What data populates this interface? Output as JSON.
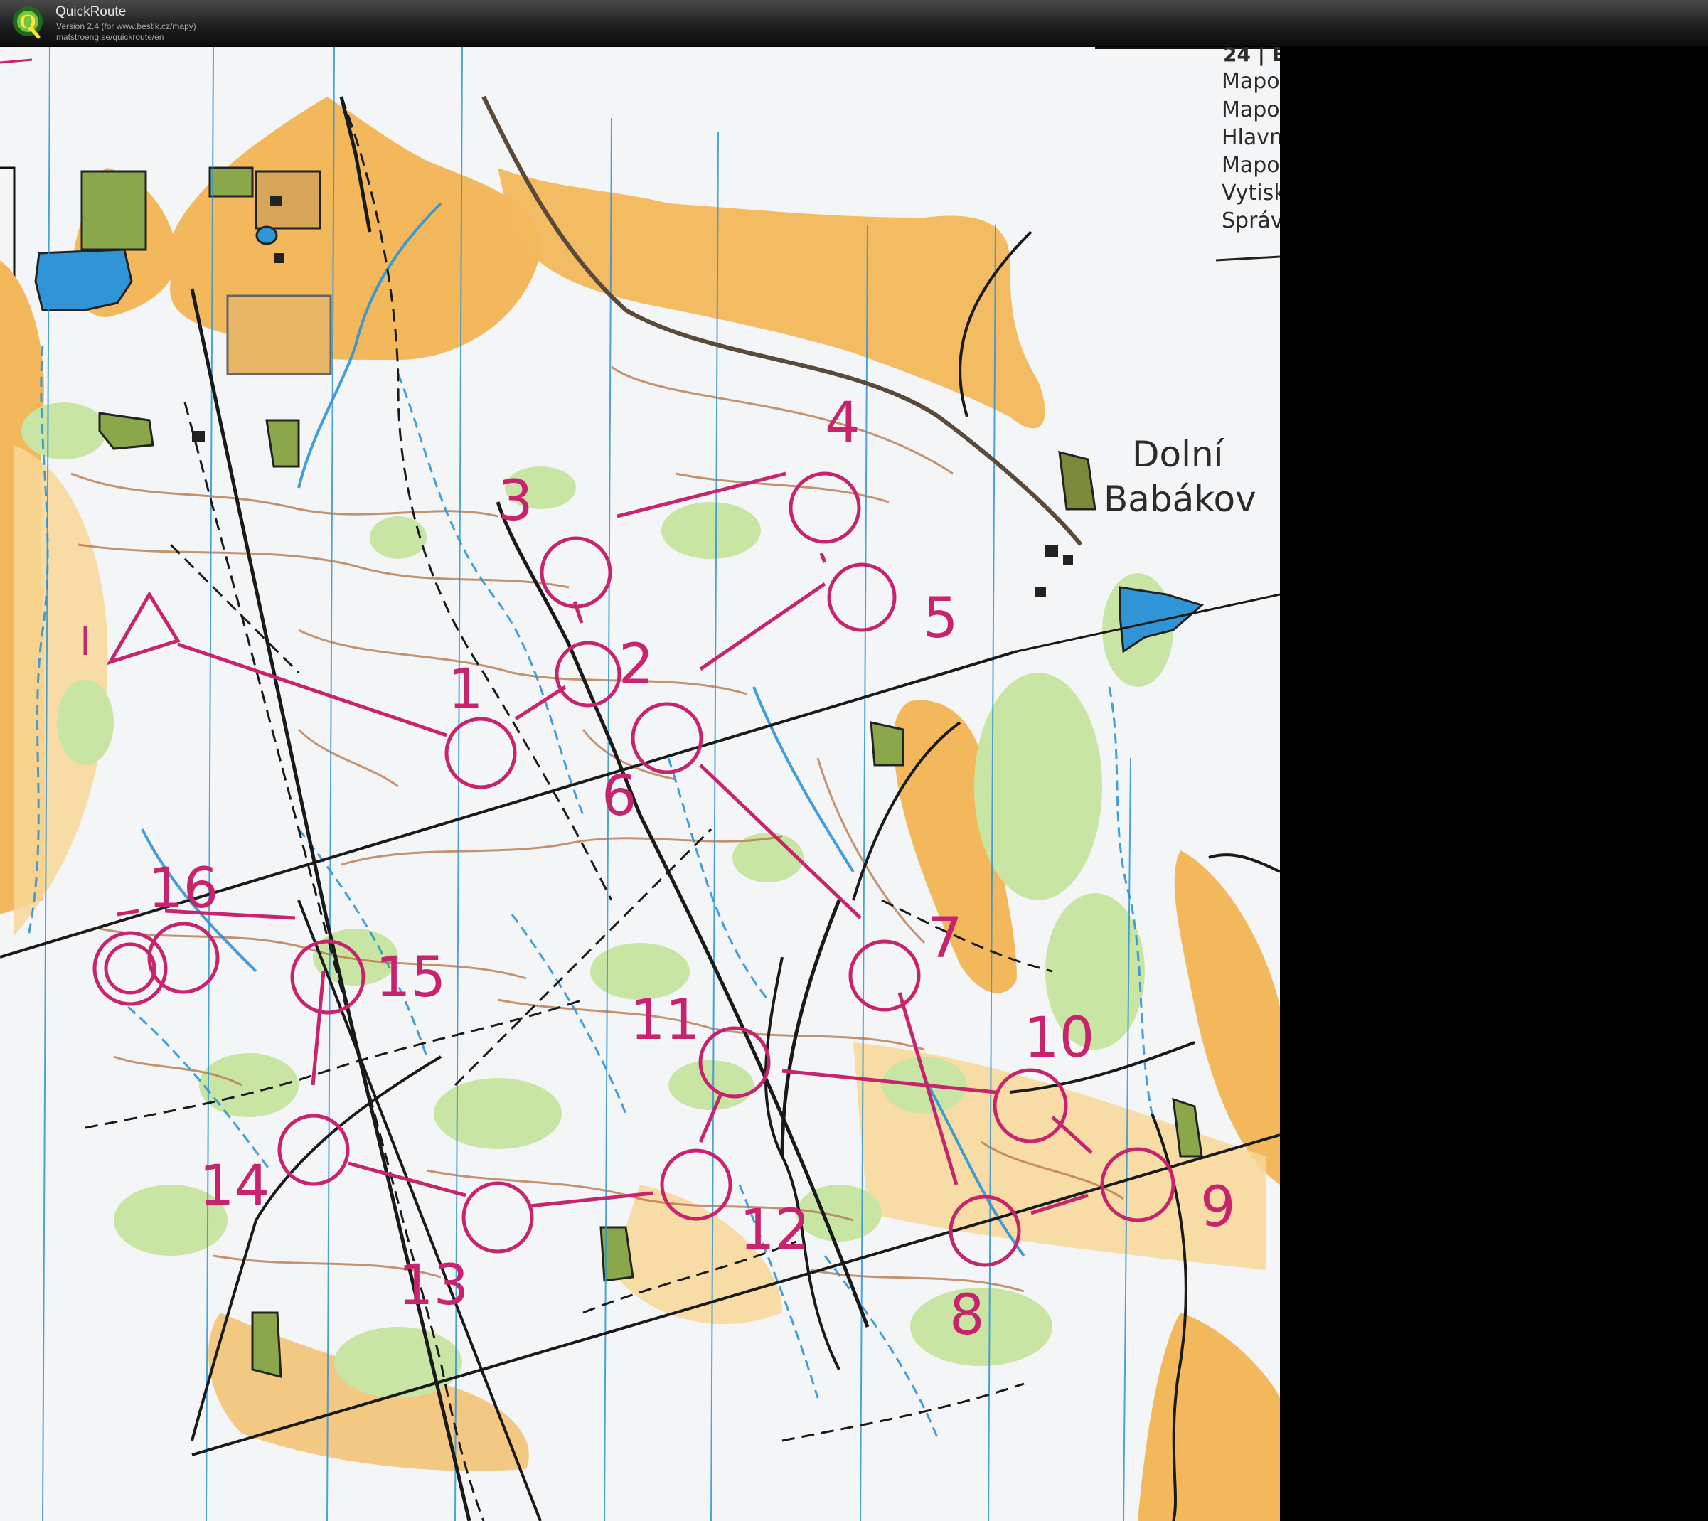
{
  "app": {
    "title": "QuickRoute",
    "version": "Version 2.4  (for www.bestik.cz/mapy)",
    "url": "matstroeng.se/quickroute/en"
  },
  "map": {
    "place_name_line1": "Dolní",
    "place_name_line2": "Babákov",
    "legend_header": "24 | E",
    "legend_lines": [
      "Mapo",
      "Mapo",
      "Hlavn",
      "Mapo",
      "Vytisk",
      "Správ"
    ],
    "course_color": "#c8246e",
    "controls": [
      "1",
      "2",
      "3",
      "4",
      "5",
      "6",
      "7",
      "8",
      "9",
      "10",
      "11",
      "12",
      "13",
      "14",
      "15",
      "16"
    ]
  },
  "colors": {
    "paper": "#f4f6f8",
    "open_land": "#f2b85b",
    "vegetation": "#c9e5a4",
    "water": "#2f95d6",
    "contour": "#b57042",
    "track": "#1a1a1a"
  }
}
